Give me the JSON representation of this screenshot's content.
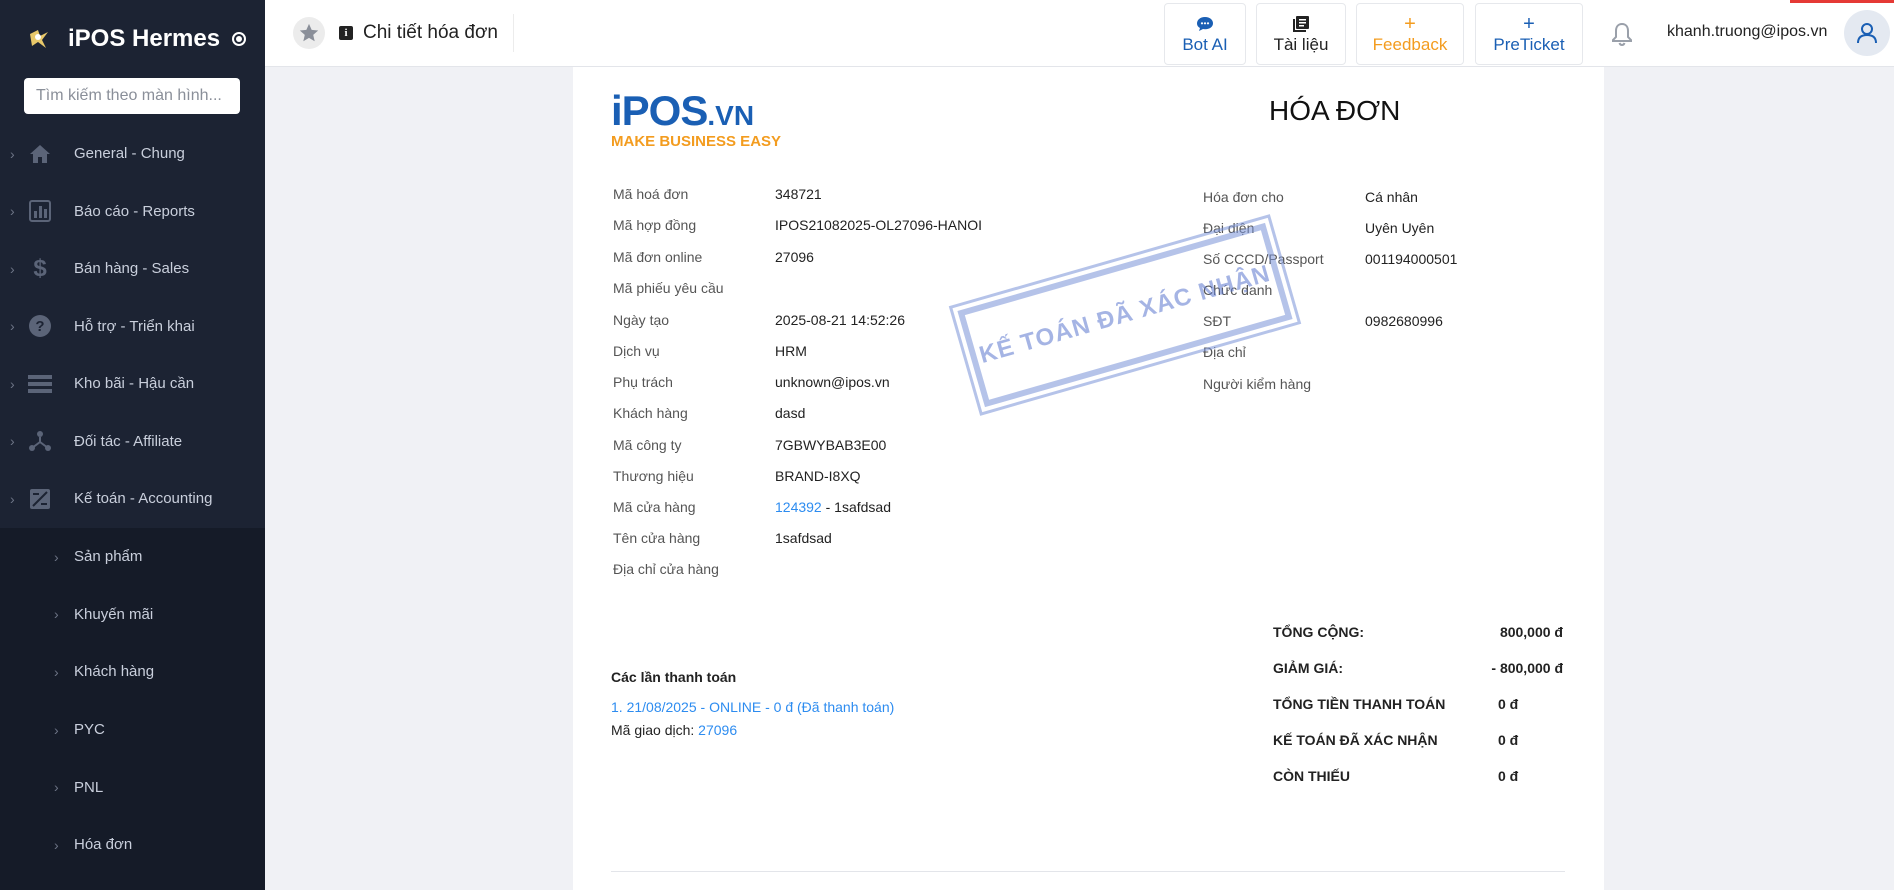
{
  "app": {
    "title": "iPOS Hermes"
  },
  "search": {
    "placeholder": "Tìm kiếm theo màn hình..."
  },
  "sidebar": {
    "items": [
      {
        "label": "General - Chung",
        "icon": "home-icon"
      },
      {
        "label": "Báo cáo - Reports",
        "icon": "bar-chart-icon"
      },
      {
        "label": "Bán hàng - Sales",
        "icon": "dollar-icon"
      },
      {
        "label": "Hỗ trợ - Triển khai",
        "icon": "help-icon"
      },
      {
        "label": "Kho bãi - Hậu cần",
        "icon": "list-icon"
      },
      {
        "label": "Đối tác - Affiliate",
        "icon": "share-icon"
      },
      {
        "label": "Kế toán - Accounting",
        "icon": "accounting-icon"
      }
    ],
    "subitems": [
      {
        "label": "Sản phẩm"
      },
      {
        "label": "Khuyến mãi"
      },
      {
        "label": "Khách hàng"
      },
      {
        "label": "PYC"
      },
      {
        "label": "PNL"
      },
      {
        "label": "Hóa đơn"
      }
    ]
  },
  "header": {
    "page_title": "Chi tiết hóa đơn",
    "buttons": {
      "bot": "Bot AI",
      "docs": "Tài liệu",
      "feedback": "Feedback",
      "preticket": "PreTicket"
    },
    "user_email": "khanh.truong@ipos.vn"
  },
  "invoice": {
    "logo_text": "iPOS",
    "logo_suffix": ".VN",
    "logo_tagline": "MAKE BUSINESS EASY",
    "title": "HÓA ĐƠN",
    "stamp": "KẾ TOÁN ĐÃ XÁC NHẬN",
    "left": [
      {
        "label": "Mã hoá đơn",
        "value": "348721"
      },
      {
        "label": "Mã hợp đồng",
        "value": "IPOS21082025-OL27096-HANOI"
      },
      {
        "label": "Mã đơn online",
        "value": "27096"
      },
      {
        "label": "Mã phiếu yêu cầu",
        "value": ""
      },
      {
        "label": "Ngày tạo",
        "value": "2025-08-21 14:52:26"
      },
      {
        "label": "Dịch vụ",
        "value": "HRM"
      },
      {
        "label": "Phụ trách",
        "value": "unknown@ipos.vn"
      },
      {
        "label": "Khách hàng",
        "value": "dasd"
      },
      {
        "label": "Mã công ty",
        "value": "7GBWYBAB3E00"
      },
      {
        "label": "Thương hiệu",
        "value": "BRAND-I8XQ"
      },
      {
        "label": "Mã cửa hàng",
        "value": "124392",
        "suffix": " - 1safdsad"
      },
      {
        "label": "Tên cửa hàng",
        "value": "1safdsad"
      },
      {
        "label": "Địa chỉ cửa hàng",
        "value": ""
      }
    ],
    "right": [
      {
        "label": "Hóa đơn cho",
        "value": "Cá nhân"
      },
      {
        "label": "Đại diện",
        "value": "Uyên Uyên"
      },
      {
        "label": "Số CCCD/Passport",
        "value": "001194000501"
      },
      {
        "label": "Chức danh",
        "value": ""
      },
      {
        "label": "SĐT",
        "value": "0982680996"
      },
      {
        "label": "Địa chỉ",
        "value": ""
      },
      {
        "label": "Người kiểm hàng",
        "value": ""
      }
    ],
    "payments": {
      "title": "Các lần thanh toán",
      "line": "1. 21/08/2025 - ONLINE - 0 đ (Đã thanh toán)",
      "code_label": "Mã giao dịch: ",
      "code": "27096"
    },
    "totals": [
      {
        "label": "TỔNG CỘNG:",
        "value": "800,000 đ"
      },
      {
        "label": "GIẢM GIÁ:",
        "value": "- 800,000 đ"
      },
      {
        "label": "TỔNG TIỀN THANH TOÁN",
        "value": "0 đ"
      },
      {
        "label": "KẾ TOÁN ĐÃ XÁC NHẬN",
        "value": "0 đ"
      },
      {
        "label": "CÒN THIẾU",
        "value": "0 đ"
      }
    ]
  },
  "colors": {
    "sidebar_bg": "#1c2333",
    "link": "#2d8cf0",
    "feedback": "#f39c1f",
    "brand_blue": "#1a5fb4",
    "stamp": "#7a93d8"
  }
}
